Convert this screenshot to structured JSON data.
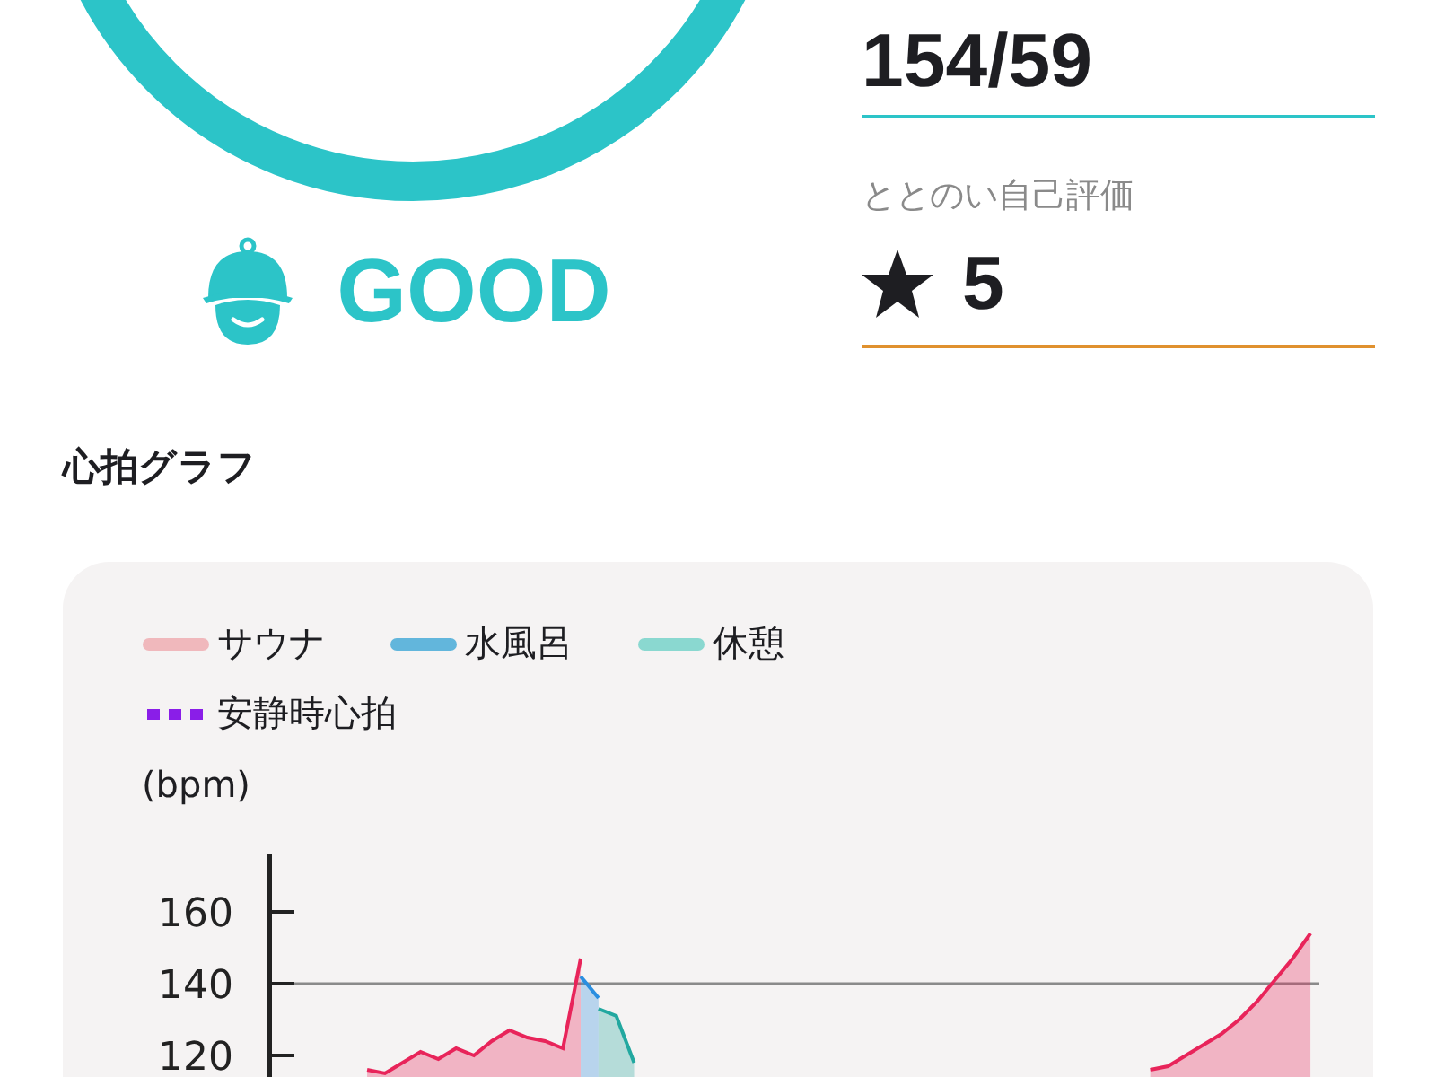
{
  "condition": {
    "status": "GOOD"
  },
  "blood_pressure": {
    "value": "154/59"
  },
  "self_rating": {
    "label": "ととのい自己評価",
    "value": "5"
  },
  "heart_rate_graph": {
    "title": "心拍グラフ",
    "legend": [
      {
        "label": "サウナ",
        "color": "#f0b8bc",
        "kind": "solid"
      },
      {
        "label": "水風呂",
        "color": "#62b6dc",
        "kind": "solid"
      },
      {
        "label": "休憩",
        "color": "#8ad8d0",
        "kind": "solid"
      },
      {
        "label": "安静時心拍",
        "color": "#8a1ee8",
        "kind": "dashed"
      }
    ],
    "chart_data": {
      "type": "area",
      "ylabel": "(bpm)",
      "ylim": [
        114,
        176
      ],
      "yticks": [
        120,
        140,
        160
      ],
      "series": [
        {
          "color": "#e8245a",
          "values": [
            null,
            null,
            null,
            null,
            null,
            116,
            115,
            118,
            121,
            119,
            122,
            120,
            124,
            127,
            125,
            124,
            122,
            147,
            null,
            null,
            null,
            null,
            null,
            null,
            null,
            null,
            null,
            null,
            null,
            null,
            null,
            null,
            null,
            null,
            null,
            null,
            null,
            null,
            null,
            null,
            null,
            null,
            null,
            null,
            null,
            null,
            null,
            null,
            null,
            116,
            117,
            120,
            123,
            126,
            130,
            135,
            141,
            147,
            154
          ]
        },
        {
          "color": "#2a8ee0",
          "values": [
            null,
            null,
            null,
            null,
            null,
            null,
            null,
            null,
            null,
            null,
            null,
            null,
            null,
            null,
            null,
            null,
            null,
            142,
            136,
            null,
            null,
            null,
            null,
            null,
            null,
            null,
            null,
            null,
            null,
            null,
            null,
            null,
            null,
            null,
            null,
            null,
            null,
            null,
            null,
            null,
            null,
            null,
            null,
            null,
            null,
            null,
            null,
            null,
            null,
            null,
            null,
            null,
            null,
            null,
            null,
            null,
            null,
            null,
            null
          ]
        },
        {
          "color": "#22a8a0",
          "values": [
            null,
            null,
            null,
            null,
            null,
            null,
            null,
            null,
            null,
            null,
            null,
            null,
            null,
            null,
            null,
            null,
            null,
            null,
            133,
            131,
            118,
            null,
            null,
            null,
            null,
            null,
            null,
            null,
            null,
            null,
            null,
            null,
            null,
            null,
            null,
            null,
            null,
            null,
            null,
            null,
            null,
            null,
            null,
            null,
            null,
            null,
            null,
            null,
            null,
            null,
            null,
            null,
            null,
            null,
            null,
            null,
            null,
            null,
            null
          ]
        }
      ]
    }
  }
}
